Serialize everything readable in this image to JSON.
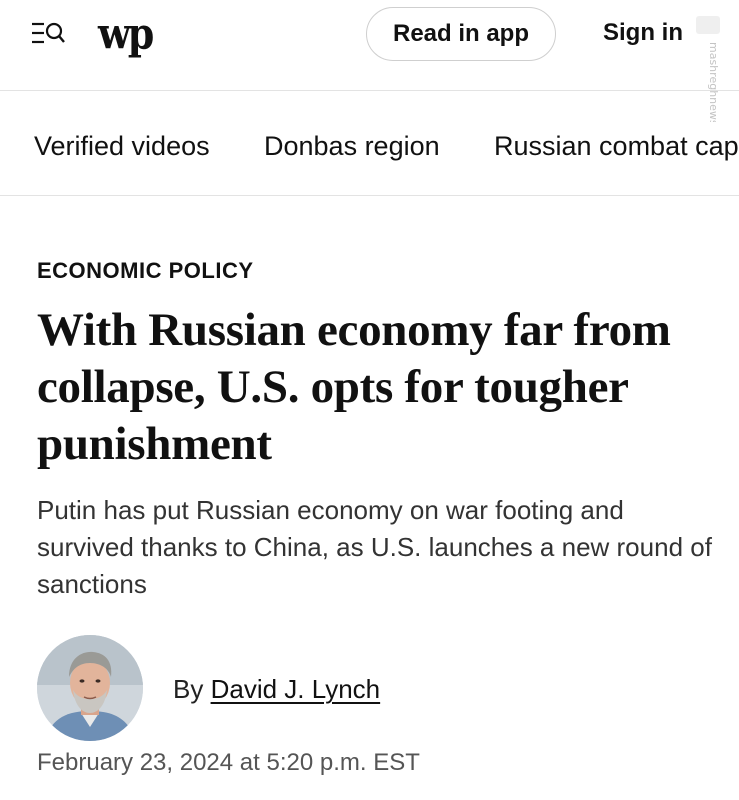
{
  "header": {
    "menu_search_icon": "menu-search-icon",
    "logo_text": "wp",
    "read_in_app_label": "Read in app",
    "sign_in_label": "Sign in",
    "watermark_text": "mashreghnews.ir"
  },
  "topics": [
    {
      "label": "Verified videos"
    },
    {
      "label": "Donbas region"
    },
    {
      "label": "Russian combat capabilities"
    }
  ],
  "article": {
    "kicker": "ECONOMIC POLICY",
    "headline": "With Russian economy far from collapse, U.S. opts for tougher punishment",
    "dek": "Putin has put Russian economy on war footing and survived thanks to China, as U.S. launches a new round of sanctions",
    "byline_prefix": "By",
    "author": "David J. Lynch",
    "timestamp": "February 23, 2024 at 5:20 p.m. EST"
  },
  "colors": {
    "text": "#111111",
    "secondary_text": "#333333",
    "timestamp": "#555555",
    "divider": "#e3e3e3",
    "button_border": "#cfcfcf"
  }
}
